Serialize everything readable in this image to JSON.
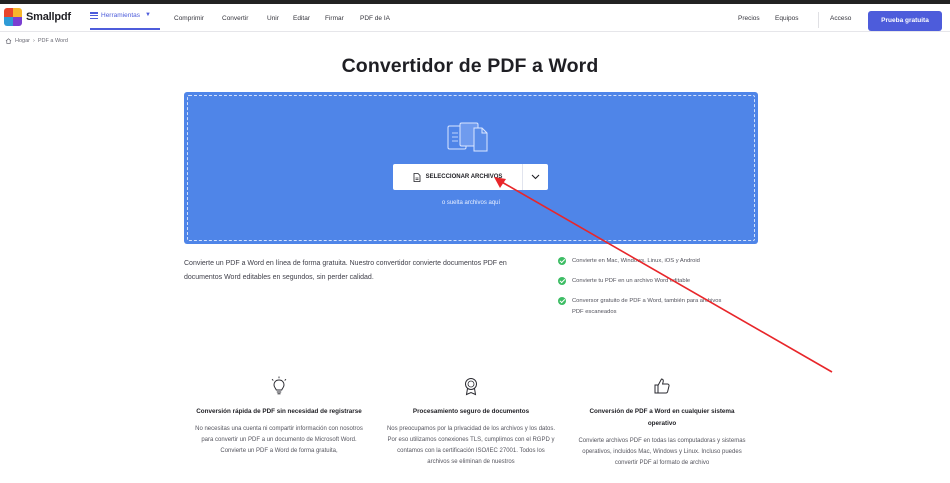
{
  "header": {
    "logo_text": "Smallpdf",
    "tools_label": "Herramientas",
    "nav": [
      "Comprimir",
      "Convertir",
      "Unir",
      "Editar",
      "Firmar",
      "PDF de IA"
    ],
    "pricing": "Precios",
    "teams": "Equipos",
    "login": "Acceso",
    "trial": "Prueba gratuita"
  },
  "breadcrumb": {
    "home": "Hogar",
    "current": "PDF a Word"
  },
  "page_title": "Convertidor de PDF a Word",
  "dropzone": {
    "select_label": "SELECCIONAR ARCHIVOS",
    "drop_text": "o suelta archivos aquí"
  },
  "description": "Convierte un PDF a Word en línea de forma gratuita. Nuestro convertidor convierte documentos PDF en documentos Word editables en segundos, sin perder calidad.",
  "checks": [
    "Convierte en Mac, Windows, Linux, iOS y Android",
    "Convierte tu PDF en un archivo Word editable",
    "Conversor gratuito de PDF a Word, también para archivos PDF escaneados"
  ],
  "features": [
    {
      "title": "Conversión rápida de PDF sin necesidad de registrarse",
      "text": "No necesitas una cuenta ni compartir información con nosotros para convertir un PDF a un documento de Microsoft Word. Convierte un PDF a Word de forma gratuita,"
    },
    {
      "title": "Procesamiento seguro de documentos",
      "text": "Nos preocupamos por la privacidad de los archivos y los datos. Por eso utilizamos conexiones TLS, cumplimos con el RGPD y contamos con la certificación ISO/IEC 27001. Todos los archivos se eliminan de nuestros"
    },
    {
      "title": "Conversión de PDF a Word en cualquier sistema operativo",
      "text": "Convierte archivos PDF en todas las computadoras y sistemas operativos, incluidos Mac, Windows y Linux. Incluso puedes convertir PDF al formato de archivo"
    }
  ],
  "colors": {
    "accent": "#4d5cdb",
    "dropzone": "#4f85e8",
    "check": "#3dbd64",
    "annotation": "#e8262a"
  }
}
